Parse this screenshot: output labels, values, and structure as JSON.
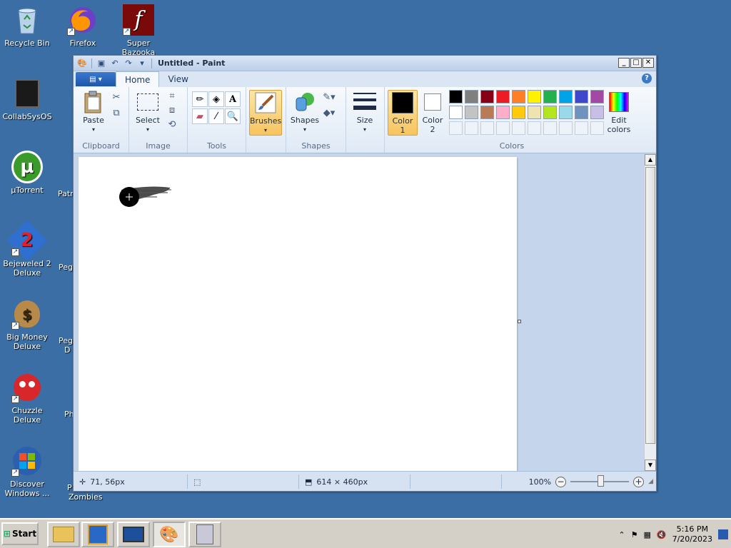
{
  "desktop": {
    "icons": [
      {
        "label": "Recycle Bin",
        "icon": "recycle-bin-icon"
      },
      {
        "label": "Firefox",
        "icon": "firefox-icon"
      },
      {
        "label": "Super Bazooka",
        "icon": "flash-icon"
      },
      {
        "label": "CollabSysOS",
        "icon": "collabsys-icon"
      },
      {
        "label": "µTorrent",
        "icon": "utorrent-icon"
      },
      {
        "label": "Bejeweled 2 Deluxe",
        "icon": "bejeweled-icon"
      },
      {
        "label": "Big Money Deluxe",
        "icon": "money-bag-icon"
      },
      {
        "label": "Chuzzle Deluxe",
        "icon": "chuzzle-icon"
      },
      {
        "label": "Discover Windows ...",
        "icon": "windows-logo-icon"
      }
    ],
    "partial_labels": [
      "Patr",
      "Peg",
      "Peg",
      "D",
      "Ph",
      "P",
      "Zombies"
    ]
  },
  "window": {
    "title": "Untitled - Paint",
    "tabs": [
      "Home",
      "View"
    ],
    "ribbon": {
      "clipboard": {
        "label": "Clipboard",
        "paste": "Paste"
      },
      "image": {
        "label": "Image",
        "select": "Select"
      },
      "tools": {
        "label": "Tools"
      },
      "brushes": "Brushes",
      "shapes": {
        "label": "Shapes",
        "button": "Shapes"
      },
      "size": "Size",
      "color1": [
        "Color",
        "1"
      ],
      "color2": [
        "Color",
        "2"
      ],
      "colors": {
        "label": "Colors",
        "edit": [
          "Edit",
          "colors"
        ],
        "row1": [
          "#000000",
          "#7f7f7f",
          "#880015",
          "#ed1c24",
          "#ff7f27",
          "#fff200",
          "#22b14c",
          "#00a2e8",
          "#3f48cc",
          "#a349a4"
        ],
        "row2": [
          "#ffffff",
          "#c3c3c3",
          "#b97a57",
          "#ffaec9",
          "#ffc90e",
          "#efe4b0",
          "#b5e61d",
          "#99d9ea",
          "#7092be",
          "#c8bfe7"
        ]
      }
    },
    "status": {
      "cursor_pos": "71, 56px",
      "canvas_size": "614 × 460px",
      "zoom": "100%"
    }
  },
  "taskbar": {
    "start": "Start",
    "time": "5:16 PM",
    "date": "7/20/2023"
  }
}
